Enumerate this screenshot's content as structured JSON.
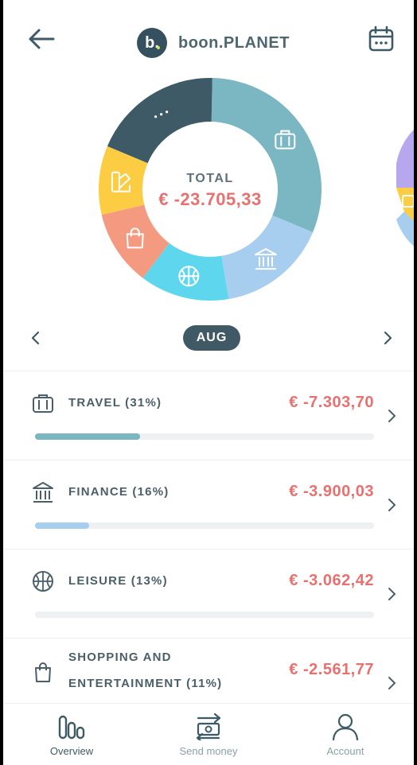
{
  "header": {
    "back_icon": "arrow-left-icon",
    "logo_letter": "b.",
    "app_name": "boon.PLANET",
    "calendar_icon": "calendar-icon"
  },
  "summary": {
    "total_label": "TOTAL",
    "total_value": "€ -23.705,33",
    "segments": [
      {
        "category": "travel",
        "share": 0.31,
        "color": "#7bb6c3",
        "icon": "briefcase-icon"
      },
      {
        "category": "finance",
        "share": 0.16,
        "color": "#a7cdef",
        "icon": "bank-icon"
      },
      {
        "category": "leisure",
        "share": 0.13,
        "color": "#5ed7ee",
        "icon": "basketball-icon"
      },
      {
        "category": "shopping",
        "share": 0.11,
        "color": "#f49a80",
        "icon": "shopping-bag-icon"
      },
      {
        "category": "other",
        "share": 0.1,
        "color": "#fccd43",
        "icon": "swatch-icon"
      },
      {
        "category": "more",
        "share": 0.19,
        "color": "#3d5a66",
        "icon": "more-icon"
      }
    ]
  },
  "month": {
    "label": "AUG"
  },
  "categories": [
    {
      "label": "TRAVEL (31%)",
      "amount": "€ -7.303,70",
      "progress": 0.31,
      "color": "#7bb6c3",
      "icon": "briefcase-icon"
    },
    {
      "label": "FINANCE (16%)",
      "amount": "€ -3.900,03",
      "progress": 0.16,
      "color": "#a7cdef",
      "icon": "bank-icon"
    },
    {
      "label": "LEISURE (13%)",
      "amount": "€ -3.062,42",
      "progress": 0.0,
      "color": "#5ed7ee",
      "icon": "basketball-icon"
    },
    {
      "label_line1": "SHOPPING AND",
      "label_line2": "ENTERTAINMENT (11%)",
      "amount": "€ -2.561,77",
      "progress": 0.0,
      "color": "#f49a80",
      "icon": "shopping-bag-icon"
    }
  ],
  "tabbar": {
    "overview": "Overview",
    "send_money": "Send money",
    "account": "Account"
  }
}
